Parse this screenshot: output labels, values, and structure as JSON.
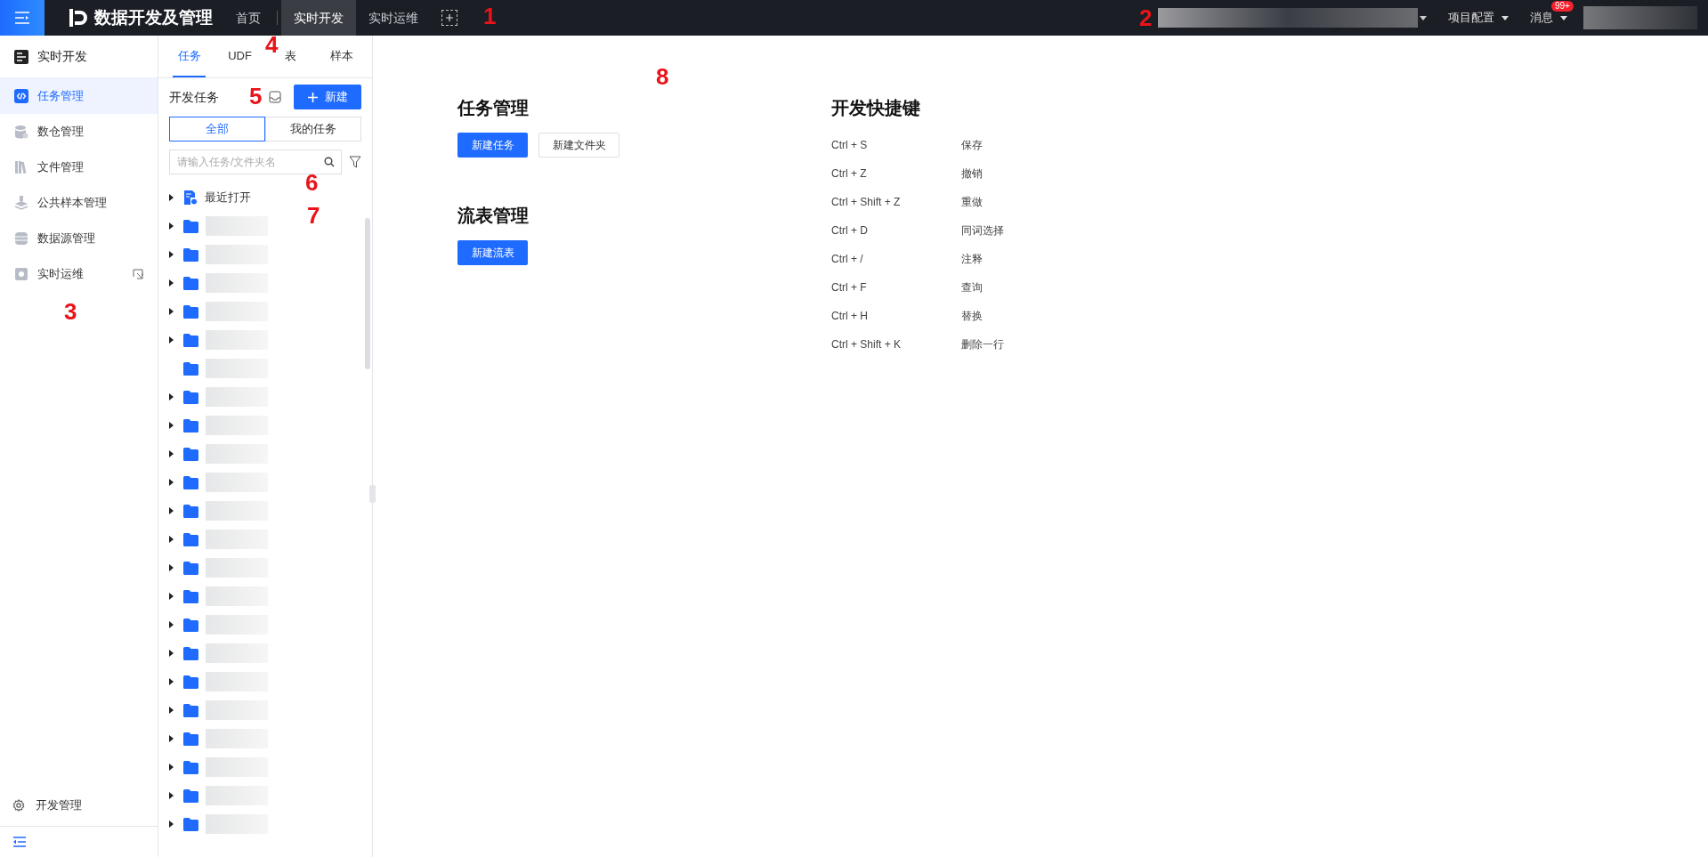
{
  "header": {
    "title": "数据开发及管理",
    "nav": [
      {
        "label": "首页",
        "selected": false
      },
      {
        "label": "实时开发",
        "selected": true
      },
      {
        "label": "实时运维",
        "selected": false
      }
    ],
    "project_config": "项目配置",
    "messages": {
      "label": "消息",
      "badge": "99+"
    }
  },
  "sidebar": {
    "title": "实时开发",
    "items": [
      {
        "label": "任务管理",
        "selected": true
      },
      {
        "label": "数仓管理",
        "selected": false
      },
      {
        "label": "文件管理",
        "selected": false
      },
      {
        "label": "公共样本管理",
        "selected": false
      },
      {
        "label": "数据源管理",
        "selected": false
      },
      {
        "label": "实时运维",
        "selected": false,
        "external": true
      }
    ],
    "footer": "开发管理"
  },
  "panel": {
    "tabs": [
      {
        "label": "任务",
        "selected": true
      },
      {
        "label": "UDF",
        "selected": false
      },
      {
        "label": "表",
        "selected": false
      },
      {
        "label": "样本",
        "selected": false
      }
    ],
    "title": "开发任务",
    "new_button": "新建",
    "scope": [
      {
        "label": "全部",
        "selected": true
      },
      {
        "label": "我的任务",
        "selected": false
      }
    ],
    "search": {
      "placeholder": "请输入任务/文件夹名"
    },
    "tree": [
      {
        "kind": "recent",
        "label": "最近打开",
        "expandable": true
      },
      {
        "kind": "folder",
        "expandable": true
      },
      {
        "kind": "folder",
        "expandable": true
      },
      {
        "kind": "folder",
        "expandable": true
      },
      {
        "kind": "folder",
        "expandable": true
      },
      {
        "kind": "folder",
        "expandable": true
      },
      {
        "kind": "folder",
        "expandable": false
      },
      {
        "kind": "folder",
        "expandable": true
      },
      {
        "kind": "folder",
        "expandable": true
      },
      {
        "kind": "folder",
        "expandable": true
      },
      {
        "kind": "folder",
        "expandable": true
      },
      {
        "kind": "folder",
        "expandable": true
      },
      {
        "kind": "folder",
        "expandable": true
      },
      {
        "kind": "folder",
        "expandable": true
      },
      {
        "kind": "folder",
        "expandable": true
      },
      {
        "kind": "folder",
        "expandable": true
      },
      {
        "kind": "folder",
        "expandable": true
      },
      {
        "kind": "folder",
        "expandable": true
      },
      {
        "kind": "folder",
        "expandable": true
      },
      {
        "kind": "folder",
        "expandable": true
      },
      {
        "kind": "folder",
        "expandable": true
      },
      {
        "kind": "folder",
        "expandable": true
      },
      {
        "kind": "folder",
        "expandable": true
      }
    ]
  },
  "main": {
    "sections": [
      {
        "title": "任务管理",
        "buttons": [
          {
            "label": "新建任务",
            "primary": true
          },
          {
            "label": "新建文件夹",
            "primary": false
          }
        ]
      },
      {
        "title": "流表管理",
        "buttons": [
          {
            "label": "新建流表",
            "primary": true
          }
        ]
      }
    ],
    "shortcuts": {
      "title": "开发快捷键",
      "rows": [
        {
          "keys": "Ctrl + S",
          "action": "保存"
        },
        {
          "keys": "Ctrl + Z",
          "action": "撤销"
        },
        {
          "keys": "Ctrl + Shift + Z",
          "action": "重做"
        },
        {
          "keys": "Ctrl + D",
          "action": "同词选择"
        },
        {
          "keys": "Ctrl + /",
          "action": "注释"
        },
        {
          "keys": "Ctrl + F",
          "action": "查询"
        },
        {
          "keys": "Ctrl + H",
          "action": "替换"
        },
        {
          "keys": "Ctrl + Shift + K",
          "action": "删除一行"
        }
      ]
    }
  },
  "annotations": [
    "1",
    "2",
    "3",
    "4",
    "5",
    "6",
    "7",
    "8"
  ]
}
